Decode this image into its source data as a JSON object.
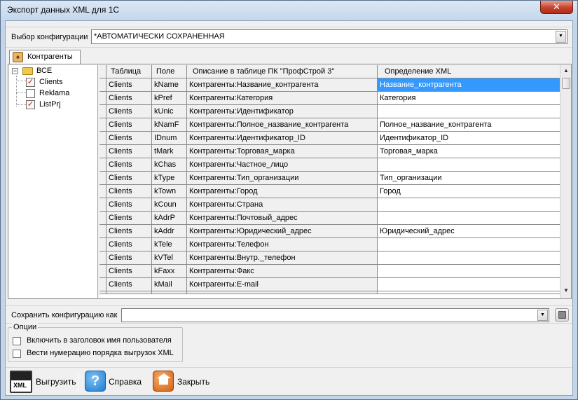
{
  "window": {
    "title": "Экспорт данных XML для 1С",
    "close_label": "✕"
  },
  "config": {
    "label": "Выбор конфигурации",
    "value": "*АВТОМАТИЧЕСКИ СОХРАНЕННАЯ"
  },
  "tab": {
    "label": "Контрагенты"
  },
  "tree": {
    "root": "ВСЕ",
    "items": [
      {
        "label": "Clients",
        "checked": true
      },
      {
        "label": "Reklama",
        "checked": false
      },
      {
        "label": "ListPrj",
        "checked": true
      }
    ]
  },
  "grid": {
    "columns": [
      "Таблица",
      "Поле",
      "Описание в таблице ПК \"ПрофСтрой 3\"",
      "Определение XML"
    ],
    "rows": [
      [
        "Clients",
        "kName",
        "Контрагенты:Название_контрагента",
        "Название_контрагента"
      ],
      [
        "Clients",
        "kPref",
        "Контрагенты:Категория",
        "Категория"
      ],
      [
        "Clients",
        "kUnic",
        "Контрагенты:Идентификатор",
        ""
      ],
      [
        "Clients",
        "kNamF",
        "Контрагенты:Полное_название_контрагента",
        "Полное_название_контрагента"
      ],
      [
        "Clients",
        "IDnum",
        "Контрагенты:Идентификатор_ID",
        "Идентификатор_ID"
      ],
      [
        "Clients",
        "tMark",
        "Контрагенты:Торговая_марка",
        "Торговая_марка"
      ],
      [
        "Clients",
        "kChas",
        "Контрагенты:Частное_лицо",
        ""
      ],
      [
        "Clients",
        "kType",
        "Контрагенты:Тип_организации",
        "Тип_организации"
      ],
      [
        "Clients",
        "kTown",
        "Контрагенты:Город",
        "Город"
      ],
      [
        "Clients",
        "kCoun",
        "Контрагенты:Страна",
        ""
      ],
      [
        "Clients",
        "kAdrP",
        "Контрагенты:Почтовый_адрес",
        ""
      ],
      [
        "Clients",
        "kAddr",
        "Контрагенты:Юридический_адрес",
        "Юридический_адрес"
      ],
      [
        "Clients",
        "kTele",
        "Контрагенты:Телефон",
        ""
      ],
      [
        "Clients",
        "kVTel",
        "Контрагенты:Внутр._телефон",
        ""
      ],
      [
        "Clients",
        "kFaxx",
        "Контрагенты:Факс",
        ""
      ],
      [
        "Clients",
        "kMail",
        "Контрагенты:E-mail",
        ""
      ]
    ],
    "selected_row": 0
  },
  "save": {
    "label": "Сохранить конфигурацию как",
    "value": ""
  },
  "options": {
    "legend": "Опции",
    "items": [
      {
        "label": "Включить в заголовок имя пользователя",
        "checked": false
      },
      {
        "label": "Вести нумерацию порядка выгрузок XML",
        "checked": false
      }
    ]
  },
  "actions": {
    "export_label": "Выгрузить",
    "export_icon_text": "XML",
    "help_label": "Справка",
    "close_label": "Закрыть"
  },
  "icons": {
    "close": "close-icon",
    "dropdown": "chevron-down-icon",
    "tab": "contractor-icon",
    "folder": "folder-icon",
    "checkbox": "checkbox-icon",
    "save_disk": "floppy-disk-icon",
    "export": "xml-export-icon",
    "help": "help-icon",
    "home": "home-icon"
  },
  "colors": {
    "selection": "#3399ff",
    "window_frame": "#c3d5e8",
    "close_button": "#c7412b",
    "client_bg": "#f0f0f0"
  }
}
